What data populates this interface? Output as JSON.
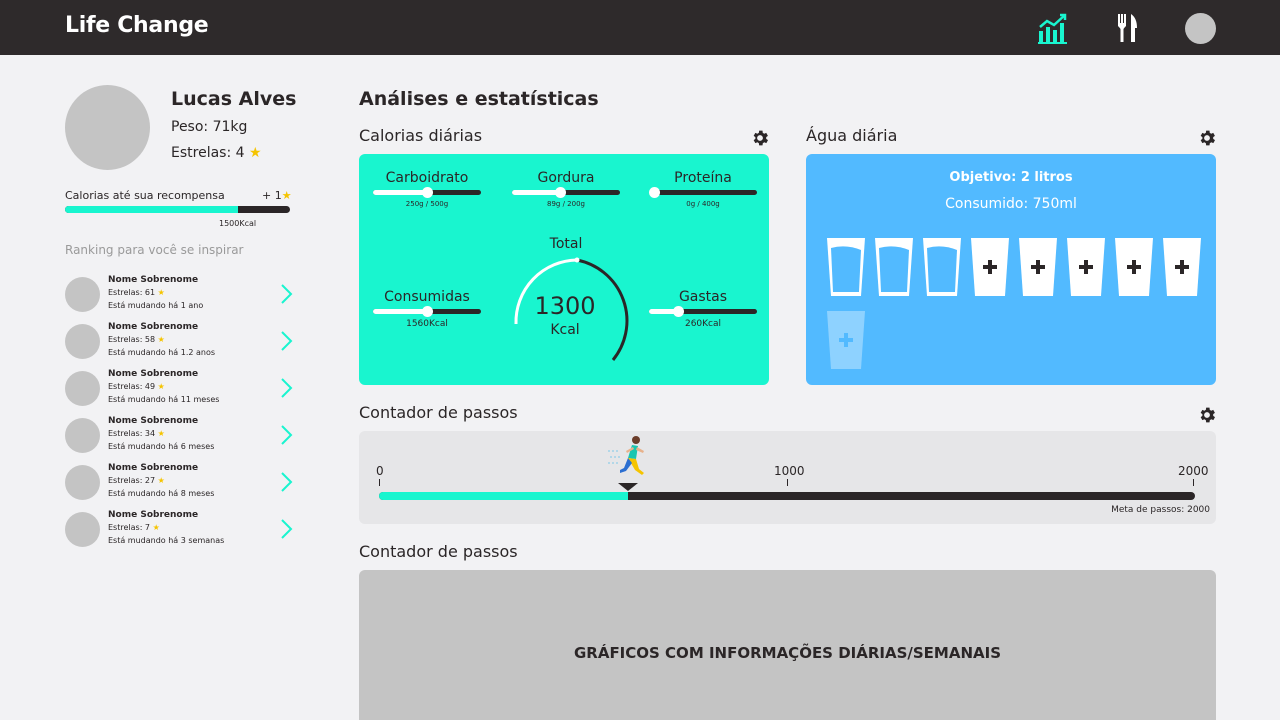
{
  "app": {
    "brand": "Life Change"
  },
  "nav": {
    "stats_icon": "bar-chart-icon",
    "food_icon": "fork-knife-icon",
    "profile_icon": "avatar"
  },
  "profile": {
    "name": "Lucas Alves",
    "weight": "Peso: 71kg",
    "stars": "Estrelas: 4",
    "star_glyph": "★"
  },
  "reward": {
    "label": "Calorias até sua recompensa",
    "plus": "+ 1",
    "kcal": "1500Kcal",
    "progress": 0.77
  },
  "ranking": {
    "title": "Ranking para você se inspirar",
    "items": [
      {
        "name": "Nome Sobrenome",
        "stars": "Estrelas: 61",
        "since": "Está mudando há 1 ano"
      },
      {
        "name": "Nome Sobrenome",
        "stars": "Estrelas: 58",
        "since": "Está mudando há 1.2 anos"
      },
      {
        "name": "Nome Sobrenome",
        "stars": "Estrelas: 49",
        "since": "Está mudando há 11 meses"
      },
      {
        "name": "Nome Sobrenome",
        "stars": "Estrelas: 34",
        "since": "Está mudando há 6 meses"
      },
      {
        "name": "Nome Sobrenome",
        "stars": "Estrelas: 27",
        "since": "Está mudando há 8 meses"
      },
      {
        "name": "Nome Sobrenome",
        "stars": "Estrelas: 7",
        "since": "Está mudando há 3 semanas"
      }
    ]
  },
  "main": {
    "title": "Análises e estatísticas",
    "calories": {
      "title": "Calorias diárias",
      "carbs": {
        "label": "Carboidrato",
        "sub": "250g / 500g",
        "progress": 0.5
      },
      "fat": {
        "label": "Gordura",
        "sub": "89g / 200g",
        "progress": 0.445
      },
      "protein": {
        "label": "Proteína",
        "sub": "0g / 400g",
        "progress": 0.0
      },
      "consumed": {
        "label": "Consumidas",
        "sub": "1560Kcal",
        "progress": 0.5
      },
      "spent": {
        "label": "Gastas",
        "sub": "260Kcal",
        "progress": 0.27
      },
      "total": {
        "label": "Total",
        "value": "1300",
        "unit": "Kcal"
      }
    },
    "water": {
      "title": "Água diária",
      "goal": "Objetivo: 2 litros",
      "consumed": "Consumido: 750ml",
      "cups_filled": 3,
      "cups_total": 8
    },
    "steps": {
      "title": "Contador de passos",
      "ticks": [
        "0",
        "1000",
        "2000"
      ],
      "goal": "Meta de passos: 2000",
      "progress": 0.305
    },
    "graph": {
      "title": "Contador de passos",
      "placeholder": "GRÁFICOS COM INFORMAÇÕES DIÁRIAS/SEMANAIS"
    }
  },
  "colors": {
    "accent": "#19f5cf",
    "water": "#52baff",
    "dark": "#2e2a2b",
    "star": "#f5c400"
  }
}
